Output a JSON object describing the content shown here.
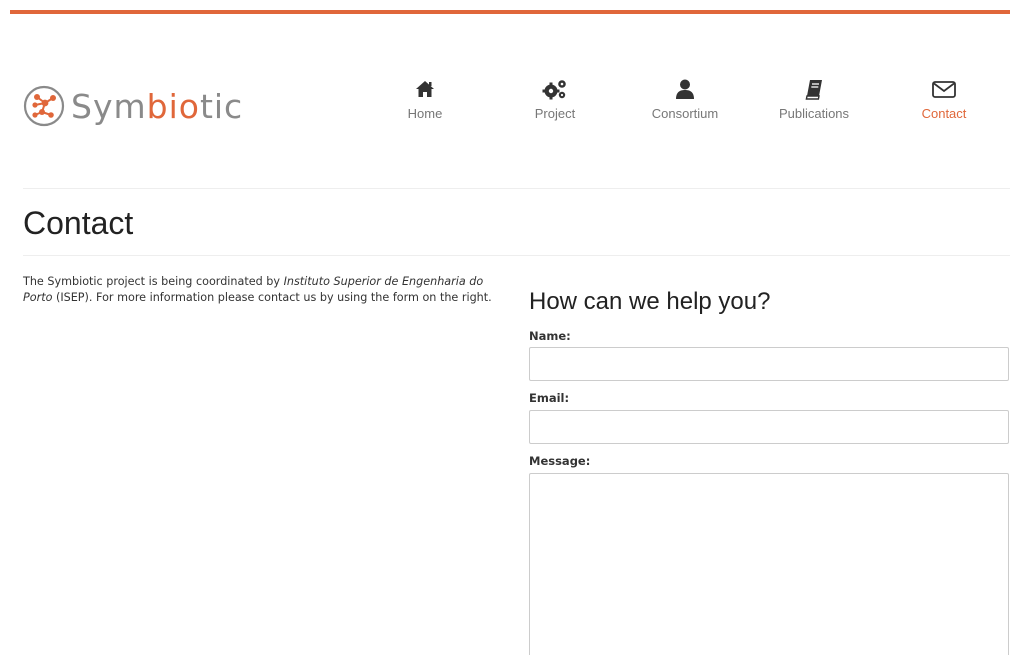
{
  "brand": {
    "name_prefix": "Sym",
    "name_accent": "bio",
    "name_suffix": "tic",
    "accent_color": "#e0673a",
    "logo_icon": "molecule-network-icon"
  },
  "nav": {
    "items": [
      {
        "label": "Home",
        "icon": "home-icon",
        "active": false
      },
      {
        "label": "Project",
        "icon": "gears-icon",
        "active": false
      },
      {
        "label": "Consortium",
        "icon": "user-icon",
        "active": false
      },
      {
        "label": "Publications",
        "icon": "book-icon",
        "active": false
      },
      {
        "label": "Contact",
        "icon": "envelope-icon",
        "active": true
      }
    ]
  },
  "page": {
    "title": "Contact"
  },
  "intro": {
    "text_before": "The Symbiotic project is being coordinated by ",
    "institution": "Instituto Superior de Engenharia do Porto",
    "text_after": " (ISEP).  For more information please contact us by using the form on the right."
  },
  "form": {
    "title": "How can we help you?",
    "name_label": "Name:",
    "name_value": "",
    "email_label": "Email:",
    "email_value": "",
    "message_label": "Message:",
    "message_value": ""
  }
}
